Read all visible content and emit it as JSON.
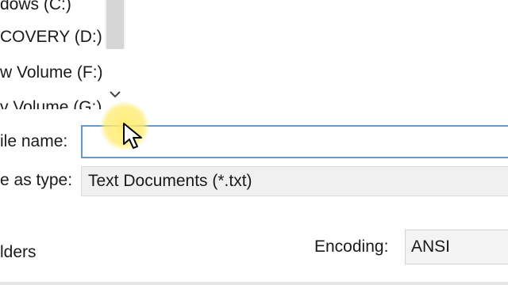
{
  "drives": [
    {
      "label": "dows (C:)"
    },
    {
      "label": "COVERY (D:)"
    },
    {
      "label": "w Volume (F:)"
    },
    {
      "label": "v Volume (G:)"
    }
  ],
  "file_name": {
    "label": "ile name:",
    "value": ""
  },
  "save_as_type": {
    "label": "e as type:",
    "value": "Text Documents (*.txt)"
  },
  "folders": {
    "label": "lders"
  },
  "encoding": {
    "label": "Encoding:",
    "value": "ANSI"
  },
  "icons": {
    "scroll_down": "chevron-down-icon",
    "cursor": "mouse-pointer-icon"
  },
  "colors": {
    "input_focus_border": "#5b9bd5",
    "cursor_highlight": "#ffec6e"
  }
}
